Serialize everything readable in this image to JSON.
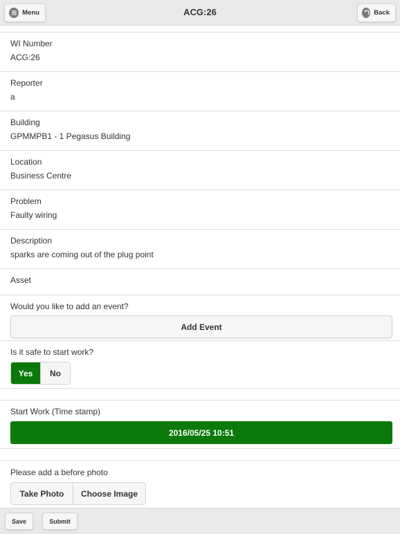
{
  "header": {
    "title": "ACG:26",
    "menu_label": "Menu",
    "back_label": "Back"
  },
  "fields": [
    {
      "label": "WI Number",
      "value": "ACG:26"
    },
    {
      "label": "Reporter",
      "value": "a"
    },
    {
      "label": "Building",
      "value": "GPMMPB1 - 1 Pegasus Building"
    },
    {
      "label": "Location",
      "value": "Business Centre"
    },
    {
      "label": "Problem",
      "value": "Faulty wiring"
    },
    {
      "label": "Description",
      "value": "sparks are coming out of the plug point"
    }
  ],
  "asset": {
    "label": "Asset"
  },
  "event": {
    "question": "Would you like to add an event?",
    "button_label": "Add Event"
  },
  "safety": {
    "question": "Is it safe to start work?",
    "options": [
      "Yes",
      "No"
    ],
    "selected": "Yes"
  },
  "start_work": {
    "label": "Start Work (Time stamp)",
    "timestamp": "2016/05/25 10:51"
  },
  "photo": {
    "label": "Please add a before photo",
    "take_label": "Take Photo",
    "choose_label": "Choose Image"
  },
  "footer": {
    "save_label": "Save",
    "submit_label": "Submit"
  },
  "colors": {
    "accent_green": "#0b7a0b",
    "toolbar_bg": "#e9e9e9"
  },
  "icons": {
    "menu": "menu-bars-icon",
    "back": "back-arrow-icon"
  }
}
